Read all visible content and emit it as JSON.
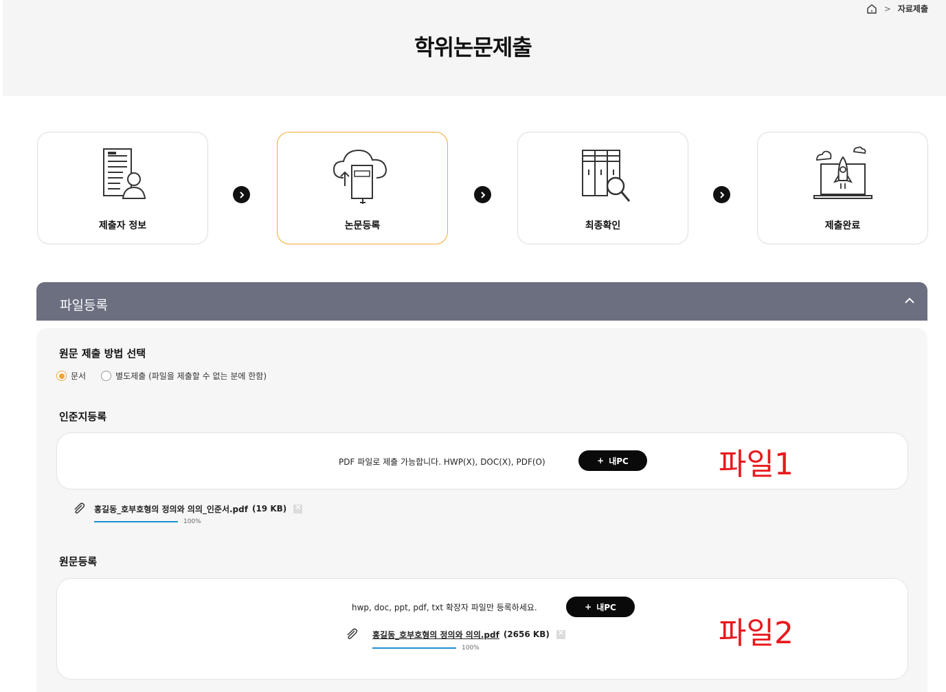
{
  "breadcrumb": {
    "home_icon": "home-icon",
    "separator": ">",
    "current": "자료제출"
  },
  "page_title": "학위논문제출",
  "steps": [
    {
      "label": "제출자 정보",
      "icon": "document-person-icon",
      "active": false
    },
    {
      "label": "논문등록",
      "icon": "cloud-book-upload-icon",
      "active": true
    },
    {
      "label": "최종확인",
      "icon": "books-magnifier-icon",
      "active": false
    },
    {
      "label": "제출완료",
      "icon": "laptop-rocket-icon",
      "active": false
    }
  ],
  "section": {
    "title": "파일등록",
    "collapse_icon": "chevron-up-icon"
  },
  "submission_method": {
    "title": "원문 제출 방법 선택",
    "options": [
      {
        "label": "문서",
        "checked": true
      },
      {
        "label": "별도제출 (파일을 제출할 수 없는 분에 한함)",
        "checked": false
      }
    ]
  },
  "approval_upload": {
    "title": "인준지등록",
    "hint": "PDF 파일로 제출 가능합니다. HWP(X), DOC(X), PDF(O)",
    "button_label": "내PC",
    "button_plus": "+",
    "annotation": "파일1",
    "file": {
      "name": "홍길동_호부호형의 정의와 의의_인준서.pdf",
      "size": "(19 KB)",
      "progress_label": "100%",
      "progress": 1.0
    }
  },
  "original_upload": {
    "title": "원문등록",
    "hint": "hwp, doc, ppt, pdf, txt 확장자 파일만 등록하세요.",
    "button_label": "내PC",
    "button_plus": "+",
    "annotation": "파일2",
    "file": {
      "name": "홍길동_호부호형의 정의와 의의.pdf",
      "size": "(2656 KB)",
      "progress_label": "100%",
      "progress": 1.0
    }
  },
  "colors": {
    "accent": "#f3a72d",
    "section_header": "#6b6f80",
    "progress": "#1b8fd3",
    "annotation": "#e8181d"
  }
}
